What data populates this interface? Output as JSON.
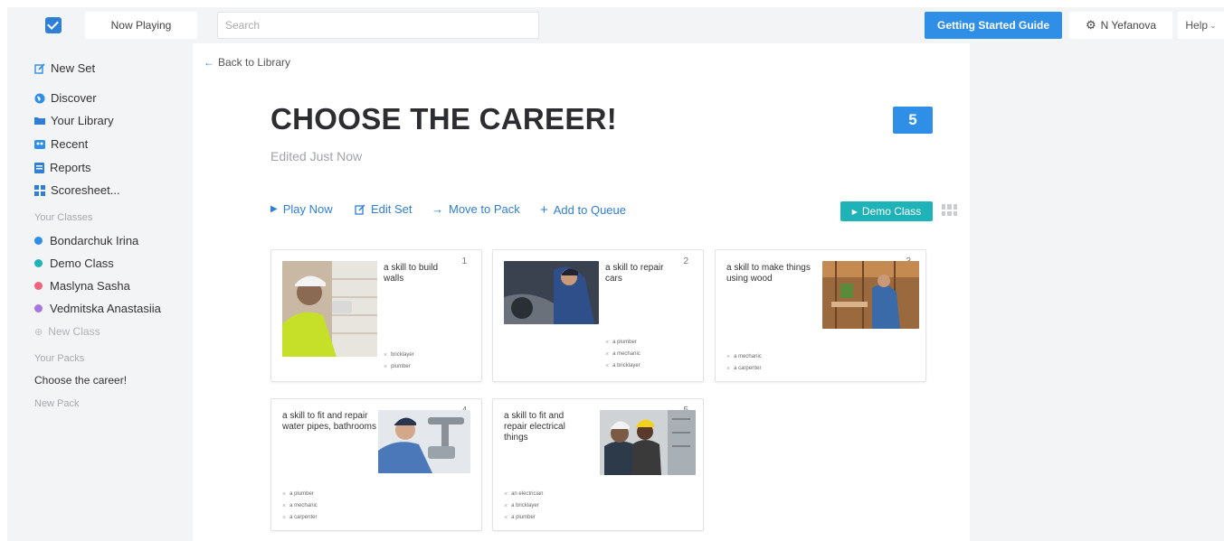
{
  "topbar": {
    "logo_icon": "checkmark-logo-icon",
    "now_playing_label": "Now Playing",
    "search_placeholder": "Search",
    "guide_button_label": "Getting Started Guide",
    "user_name": "N Yefanova",
    "help_label": "Help",
    "accent_color": "#2f8ee6"
  },
  "sidebar": {
    "nav": [
      {
        "label": "New Set",
        "icon": "edit-icon"
      },
      {
        "label": "Discover",
        "icon": "globe-icon"
      },
      {
        "label": "Your Library",
        "icon": "folder-icon"
      },
      {
        "label": "Recent",
        "icon": "recent-icon"
      },
      {
        "label": "Reports",
        "icon": "reports-icon"
      },
      {
        "label": "Scoresheet...",
        "icon": "grid-icon"
      }
    ],
    "classes_heading": "Your Classes",
    "classes": [
      {
        "label": "Bondarchuk Irina",
        "color": "#2f8ee6"
      },
      {
        "label": "Demo Class",
        "color": "#1fb3b8"
      },
      {
        "label": "Maslyna Sasha",
        "color": "#f0627a"
      },
      {
        "label": "Vedmitska Anastasiia",
        "color": "#a675e0"
      }
    ],
    "new_class_label": "New Class",
    "packs_heading": "Your Packs",
    "packs": [
      "Choose the career!"
    ],
    "new_pack_label": "New Pack"
  },
  "main": {
    "back_label": "Back to Library",
    "title": "CHOOSE THE CAREER!",
    "edited": "Edited Just Now",
    "question_count": "5",
    "actions": {
      "play": "Play Now",
      "edit": "Edit Set",
      "move": "Move to Pack",
      "queue": "Add to Queue"
    },
    "demo_class_label": "Demo Class",
    "demo_class_color": "#1fb3b8"
  },
  "cards": [
    {
      "number": "1",
      "question": "a skill to build walls",
      "answers": [
        "bricklayer",
        "plumber"
      ],
      "image_desc": "bricklayer-photo"
    },
    {
      "number": "2",
      "question": "a skill to repair cars",
      "answers": [
        "a plumber",
        "a mechanic",
        "a bricklayer"
      ],
      "image_desc": "mechanic-photo"
    },
    {
      "number": "3",
      "question": "a skill to make things using wood",
      "answers": [
        "a mechanic",
        "a carpenter"
      ],
      "image_desc": "carpenter-photo"
    },
    {
      "number": "4",
      "question": "a skill to fit and repair water pipes, bathrooms",
      "answers": [
        "a plumber",
        "a mechanic",
        "a carpenter"
      ],
      "image_desc": "plumber-photo"
    },
    {
      "number": "5",
      "question": "a skill to fit and repair electrical things",
      "answers": [
        "an electrician",
        "a bricklayer",
        "a plumber"
      ],
      "image_desc": "electrician-photo"
    }
  ]
}
